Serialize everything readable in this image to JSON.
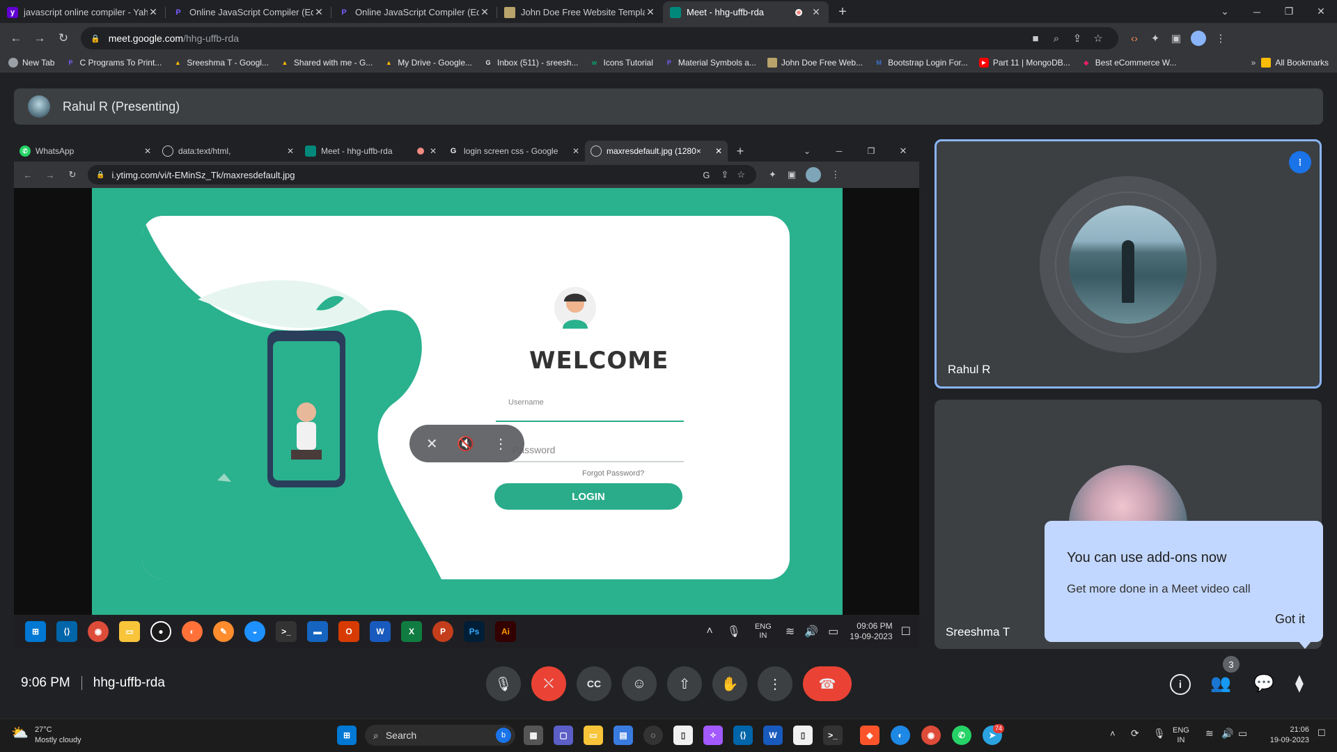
{
  "browser": {
    "tabs": [
      {
        "title": "javascript online compiler - Yahoo",
        "favicon": "yahoo-icon",
        "color": "#6001d2"
      },
      {
        "title": "Online JavaScript Compiler (Editor)",
        "favicon": "programiz-icon",
        "color": "#5b2ee8"
      },
      {
        "title": "Online JavaScript Compiler (Editor)",
        "favicon": "programiz-icon",
        "color": "#5b2ee8"
      },
      {
        "title": "John Doe Free Website Template",
        "favicon": "template-icon",
        "color": "#b8a46a"
      },
      {
        "title": "Meet - hhg-uffb-rda",
        "favicon": "meet-icon",
        "color": "#00897b",
        "active": true,
        "recording": true
      }
    ],
    "url_host": "meet.google.com",
    "url_path": "/hhg-uffb-rda",
    "bookmarks": [
      {
        "label": "New Tab",
        "icon": "globe-icon"
      },
      {
        "label": "C Programs To Print...",
        "icon": "bookmark-icon"
      },
      {
        "label": "Sreeshma T - Googl...",
        "icon": "drive-icon"
      },
      {
        "label": "Shared with me - G...",
        "icon": "drive-icon"
      },
      {
        "label": "My Drive - Google...",
        "icon": "drive-icon"
      },
      {
        "label": "Inbox (511) - sreesh...",
        "icon": "google-icon"
      },
      {
        "label": "Icons Tutorial",
        "icon": "w3schools-icon"
      },
      {
        "label": "Material Symbols a...",
        "icon": "material-icon"
      },
      {
        "label": "John Doe Free Web...",
        "icon": "template-icon"
      },
      {
        "label": "Bootstrap Login For...",
        "icon": "mdb-icon"
      },
      {
        "label": "Part 11 | MongoDB...",
        "icon": "youtube-icon"
      },
      {
        "label": "Best eCommerce W...",
        "icon": "bookmark-icon"
      }
    ],
    "all_bookmarks": "All Bookmarks"
  },
  "meet": {
    "presenting_label": "Rahul R (Presenting)",
    "shared_screen": {
      "tabs": [
        {
          "title": "WhatsApp",
          "favicon": "whatsapp-icon"
        },
        {
          "title": "data:text/html,",
          "favicon": "globe-icon"
        },
        {
          "title": "Meet - hhg-uffb-rda",
          "favicon": "meet-icon"
        },
        {
          "title": "login screen css - Google",
          "favicon": "google-icon"
        },
        {
          "title": "maxresdefault.jpg (1280×",
          "favicon": "globe-icon",
          "active": true
        }
      ],
      "url": "i.ytimg.com/vi/t-EMinSz_Tk/maxresdefault.jpg",
      "login": {
        "welcome": "WELCOME",
        "username_placeholder": "Username",
        "password_placeholder": "Password",
        "forgot": "Forgot Password?",
        "button": "LOGIN"
      },
      "taskbar": {
        "lang": "ENG",
        "region": "IN",
        "time": "09:06 PM",
        "date": "19-09-2023"
      }
    },
    "participants": [
      {
        "name": "Rahul R",
        "speaking": true
      },
      {
        "name": "Sreeshma T"
      }
    ],
    "addons_popup": {
      "title": "You can use add-ons now",
      "body": "Get more done in a Meet video call",
      "action": "Got it"
    },
    "footer": {
      "time": "9:06 PM",
      "meeting_code": "hhg-uffb-rda",
      "people_count": "3"
    }
  },
  "windows": {
    "weather_temp": "27°C",
    "weather_desc": "Mostly cloudy",
    "search": "Search",
    "lang": "ENG",
    "region": "IN",
    "time": "21:06",
    "date": "19-09-2023",
    "telegram_badge": "74"
  }
}
